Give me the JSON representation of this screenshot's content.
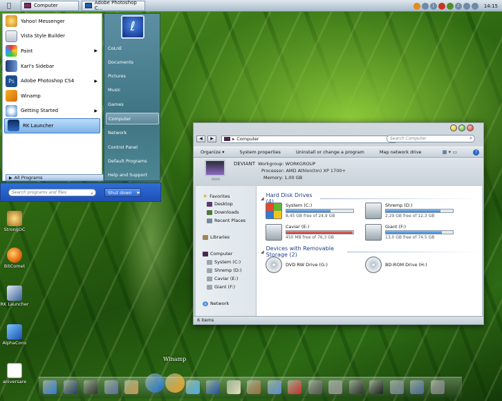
{
  "taskbar": {
    "buttons": [
      {
        "label": "Computer"
      },
      {
        "label": "Adobe Photoshop C..."
      }
    ],
    "tray_icons": [
      "firefox-icon",
      "messenger-icon",
      "bluetooth-icon",
      "shield-icon",
      "network-icon",
      "volume-icon",
      "power-icon",
      "language-icon"
    ],
    "clock": "14:15"
  },
  "start_menu": {
    "left_items": [
      {
        "label": "Yahoo! Messenger",
        "icon": "yahoo-icon",
        "has_submenu": false
      },
      {
        "label": "Vista Style Builder",
        "icon": "builder-icon",
        "has_submenu": false
      },
      {
        "label": "Paint",
        "icon": "paint-icon",
        "has_submenu": true
      },
      {
        "label": "Karl's Sidebar",
        "icon": "sidebar-icon",
        "has_submenu": false
      },
      {
        "label": "Adobe Photoshop CS4",
        "icon": "photoshop-icon",
        "has_submenu": true
      },
      {
        "label": "Winamp",
        "icon": "winamp-icon",
        "has_submenu": false
      },
      {
        "label": "Getting Started",
        "icon": "getting-started-icon",
        "has_submenu": true
      },
      {
        "label": "RK Launcher",
        "icon": "rk-launcher-icon",
        "has_submenu": false
      }
    ],
    "all_programs": "All Programs",
    "right_items": [
      "CoLnE",
      "Documents",
      "Pictures",
      "Music",
      "Games",
      "Computer",
      "Network",
      "Control Panel",
      "Default Programs",
      "Help and Support"
    ],
    "search_placeholder": "Search programs and files",
    "shutdown": "Shut down"
  },
  "desktop_icons": [
    "StrongDC",
    "BitComet",
    "RK Launcher",
    "AlphaConv",
    "aniversare"
  ],
  "explorer": {
    "address": "Computer",
    "search_placeholder": "Search Computer",
    "toolbar": [
      "Organize",
      "System properties",
      "Uninstall or change a program",
      "Map network drive"
    ],
    "info": {
      "name": "DEVIANT",
      "workgroup": "Workgroup: WORKGROUP",
      "processor": "Processor: AMD Athlon(tm) XP 1700+",
      "memory": "Memory: 1,00 GB"
    },
    "sidebar": {
      "favorites": "Favorites",
      "fav_items": [
        "Desktop",
        "Downloads",
        "Recent Places"
      ],
      "libraries": "Libraries",
      "computer": "Computer",
      "computer_items": [
        "System (C:)",
        "Shremp (D:)",
        "Caviar (E:)",
        "Giant (F:)"
      ],
      "network": "Network"
    },
    "groups": {
      "hard_disks": "Hard Disk Drives (4)",
      "removable": "Devices with Removable Storage (2)"
    },
    "drives": [
      {
        "name": "System (C:)",
        "free": "8,45 GB free of 24,9 GB",
        "used_fraction": 0.66,
        "critical": false,
        "type": "win"
      },
      {
        "name": "Shremp (D:)",
        "free": "2,29 GB free of 12,3 GB",
        "used_fraction": 0.81,
        "critical": false,
        "type": "hdd"
      },
      {
        "name": "Caviar (E:)",
        "free": "450 MB free of 76,3 GB",
        "used_fraction": 0.99,
        "critical": true,
        "type": "hdd"
      },
      {
        "name": "Giant (F:)",
        "free": "13,0 GB free of 74,5 GB",
        "used_fraction": 0.83,
        "critical": false,
        "type": "hdd"
      }
    ],
    "removable": [
      {
        "name": "DVD RW Drive (G:)"
      },
      {
        "name": "BD-ROM Drive (H:)"
      }
    ],
    "status": "6 items"
  },
  "dock": {
    "label": "Winamp",
    "items": [
      "finder-icon",
      "window-icon",
      "clock-icon",
      "pen-icon",
      "addressbook-icon",
      "media-player-icon",
      "winamp-icon",
      "messenger-icon",
      "globe-icon",
      "notes-icon",
      "tools-icon",
      "folder-icon",
      "pdf-icon",
      "printer-icon",
      "calculator-icon",
      "terminal-icon",
      "power-icon",
      "home-icon",
      "download-icon",
      "trash-icon"
    ]
  }
}
